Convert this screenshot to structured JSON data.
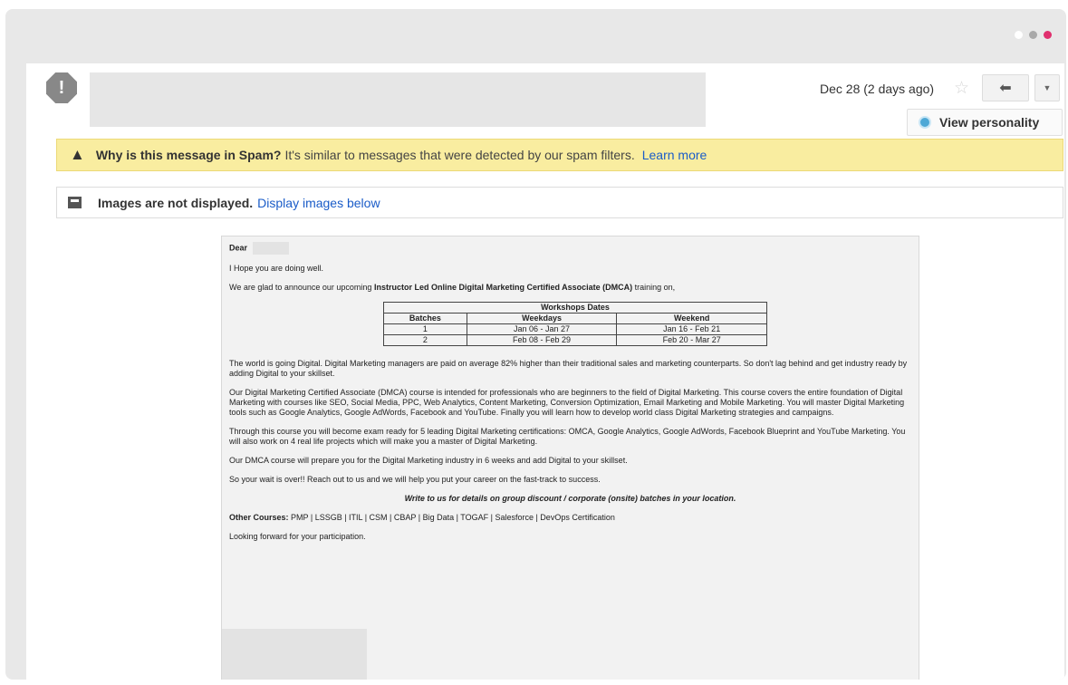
{
  "window": {
    "dots": [
      "#ffffff",
      "#a9a9a9",
      "#e0306e"
    ]
  },
  "header": {
    "avatar_glyph": "!",
    "date": "Dec 28 (2 days ago)",
    "star_glyph": "☆",
    "reply_glyph": "⬅",
    "more_glyph": "▼",
    "personality_label": "View personality"
  },
  "spam_banner": {
    "icon": "warning-icon",
    "icon_glyph": "▲",
    "title": "Why is this message in Spam?",
    "text": "It's similar to messages that were detected by our spam filters.",
    "link": "Learn more",
    "bg_color": "#f9eda0"
  },
  "images_bar": {
    "icon": "image-icon",
    "title": "Images are not displayed.",
    "link": "Display images below"
  },
  "email": {
    "greeting": "Dear",
    "hope": "I Hope you are doing well.",
    "announce_pre": "We are glad to announce our upcoming ",
    "announce_bold": "Instructor Led Online Digital Marketing Certified Associate (DMCA)",
    "announce_post": " training on,",
    "table": {
      "title": "Workshops Dates",
      "headers": [
        "Batches",
        "Weekdays",
        "Weekend"
      ],
      "rows": [
        [
          "1",
          "Jan 06 - Jan 27",
          "Jan 16 - Feb 21"
        ],
        [
          "2",
          "Feb 08 - Feb 29",
          "Feb 20 - Mar 27"
        ]
      ]
    },
    "para1": "The world is going Digital. Digital Marketing managers are paid on average 82% higher than their traditional sales and marketing counterparts. So don't lag behind and get industry ready by adding Digital to your skillset.",
    "para2": "Our Digital Marketing Certified Associate (DMCA) course is intended for professionals who are beginners to the field of Digital Marketing. This course covers the entire foundation of Digital Marketing with courses like SEO, Social Media, PPC, Web Analytics, Content Marketing, Conversion Optimization, Email Marketing and Mobile Marketing. You will master Digital Marketing tools such as Google Analytics, Google AdWords, Facebook and YouTube. Finally you will learn how to develop world class Digital Marketing strategies and campaigns.",
    "para3": "Through this course you will become exam ready for 5 leading Digital Marketing certifications: OMCA, Google Analytics, Google AdWords, Facebook Blueprint and YouTube Marketing. You will also work on 4 real life projects which will make you a master of Digital Marketing.",
    "para4": "Our DMCA course will prepare you for the Digital Marketing industry in 6 weeks and add Digital to your skillset.",
    "para5": "So your wait is over!! Reach out to us and we will help you put your career on the fast-track to success.",
    "cta": "Write to us for details on group discount / corporate (onsite) batches in your location.",
    "other_label": "Other Courses:",
    "other_list": " PMP | LSSGB | ITIL | CSM | CBAP | Big Data | TOGAF | Salesforce | DevOps Certification",
    "closing": "Looking forward for your participation."
  }
}
